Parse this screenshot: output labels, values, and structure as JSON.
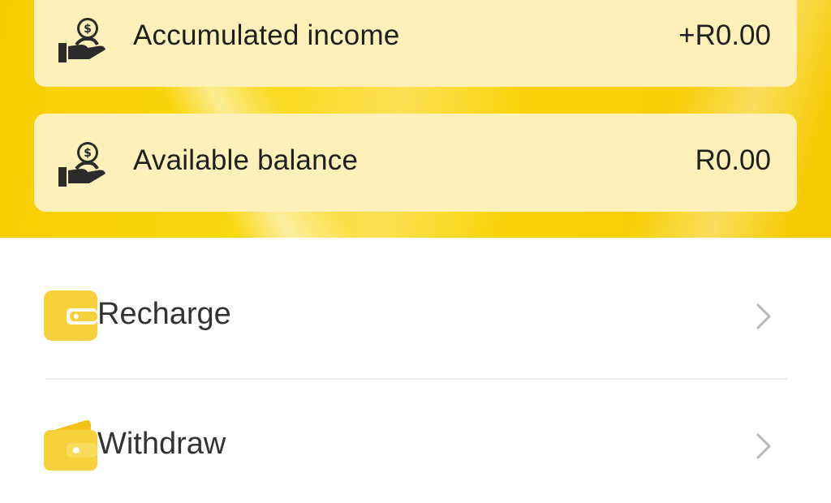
{
  "summary": {
    "income": {
      "label": "Accumulated income",
      "value": "+R0.00",
      "icon": "hand-money-bag-icon"
    },
    "balance": {
      "label": "Available balance",
      "value": "R0.00",
      "icon": "hand-money-bag-icon"
    }
  },
  "menu": {
    "recharge": {
      "label": "Recharge",
      "icon": "card-wallet-icon"
    },
    "withdraw": {
      "label": "Withdraw",
      "icon": "wallet-icon"
    }
  },
  "colors": {
    "brand_yellow": "#f7cd00",
    "card_background": "#fdf0b8",
    "icon_yellow": "#f6d13a",
    "icon_dark": "#2b2b2b",
    "chevron": "#b5b5b5"
  }
}
